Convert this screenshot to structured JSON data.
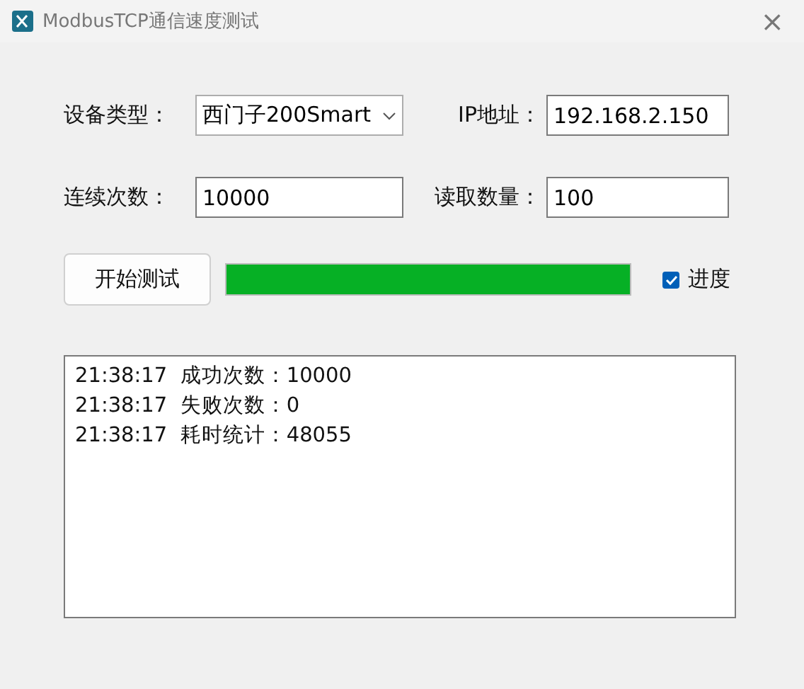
{
  "window": {
    "title": "ModbusTCP通信速度测试",
    "close": "×"
  },
  "form": [
    {
      "label": "设备类型：",
      "kind": "select",
      "value": "西门子200Smart"
    },
    {
      "label": "IP地址：",
      "kind": "input",
      "value": "192.168.2.150"
    },
    {
      "label": "连续次数：",
      "kind": "input",
      "value": "10000"
    },
    {
      "label": "读取数量：",
      "kind": "input",
      "value": "100"
    }
  ],
  "start_button": "开始测试",
  "progress": {
    "level": 1.0
  },
  "progress_checkbox": {
    "label": "进度",
    "checked": true
  },
  "log": [
    "21:38:17  成功次数：10000",
    "21:38:17  失败次数：0",
    "21:38:17  耗时统计：48055"
  ]
}
